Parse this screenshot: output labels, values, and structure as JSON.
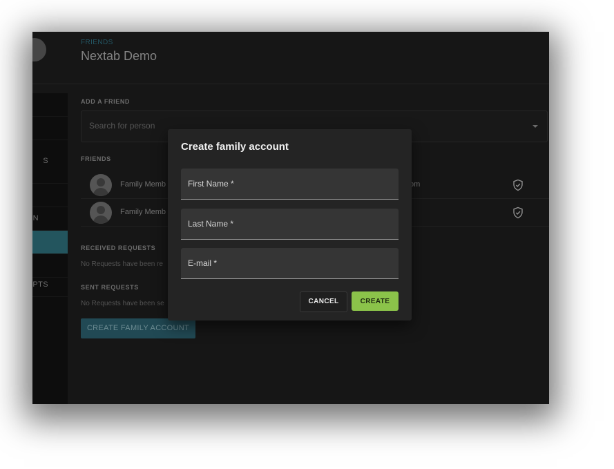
{
  "header": {
    "kicker": "FRIENDS",
    "title": "Nextab Demo"
  },
  "sidebar": {
    "items": [
      {
        "label": ""
      },
      {
        "label": ""
      },
      {
        "label": "S"
      },
      {
        "label": ""
      },
      {
        "label": "ON"
      },
      {
        "label": "",
        "active": true
      },
      {
        "label": ""
      },
      {
        "label": "PTS"
      }
    ]
  },
  "add_friend": {
    "label": "ADD A FRIEND",
    "placeholder": "Search for person"
  },
  "friends": {
    "label": "FRIENDS",
    "rows": [
      {
        "name": "Family Memb",
        "email_tail": "om"
      },
      {
        "name": "Family Memb",
        "email_tail": ""
      }
    ]
  },
  "received_requests": {
    "label": "RECEIVED REQUESTS",
    "empty_text": "No Requests have been re"
  },
  "sent_requests": {
    "label": "SENT REQUESTS",
    "empty_text": "No Requests have been se"
  },
  "family_button_label": "CREATE FAMILY ACCOUNT",
  "modal": {
    "title": "Create family account",
    "fields": {
      "first_name": "First Name *",
      "last_name": "Last Name *",
      "email": "E-mail *"
    },
    "cancel_label": "CANCEL",
    "create_label": "CREATE"
  },
  "colors": {
    "accent": "#2e6d79",
    "create_button": "#8bc34a",
    "background": "#1d1d1d"
  }
}
